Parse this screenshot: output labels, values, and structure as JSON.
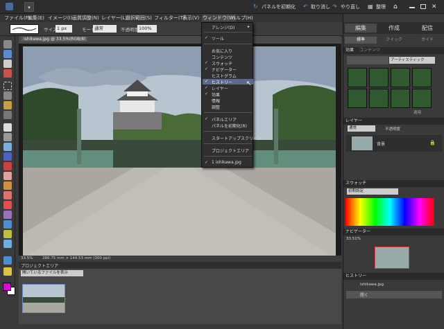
{
  "menubar": {
    "items": [
      "ファイル(F)",
      "編集(E)",
      "イメージ(I)",
      "画質調整(N)",
      "レイヤー(L)",
      "選択範囲(S)",
      "フィルター(T)",
      "表示(V)",
      "ウィンドウ(W)",
      "ヘルプ(H)"
    ]
  },
  "header": {
    "reset_panels": "パネルを初期化",
    "undo": "取り消し",
    "redo": "やり直し",
    "organize": "整理"
  },
  "options": {
    "size_label": "サイズ",
    "size_value": "1 px",
    "mode_label": "モード",
    "mode_value": "通常",
    "opacity_label": "不透明度",
    "opacity_value": "100%"
  },
  "document": {
    "tab": "ishikawa.jpg @ 33.5%(RGB/8)",
    "status": "33.5%",
    "status_info": "266.75 mm × 144.53 mm (300 ppi)"
  },
  "project": {
    "title": "プロジェクトエリア",
    "selector": "開いているファイルを表示"
  },
  "right": {
    "tabs": [
      "編集",
      "作成",
      "配信"
    ],
    "subtabs": [
      "標準",
      "クイック",
      "ガイド"
    ],
    "effects_tab1": "効果",
    "effects_tab2": "コンテンツ",
    "effects_select": "アーティスティック",
    "apply": "適用",
    "layers_title": "レイヤー",
    "blend": "通常",
    "opacity": "不透明度",
    "layer_name": "背景",
    "swatches_title": "スウォッチ",
    "swatch_select": "初期設定",
    "navigator_title": "ナビゲーター",
    "zoom": "33.51%",
    "history_title": "ヒストリー",
    "history_items": [
      "ishikawa.jpg",
      "開く"
    ]
  },
  "window_menu": {
    "items": [
      "アレンジ(D)",
      "ツール",
      "お気に入り",
      "コンテンツ",
      "スウォッチ",
      "ナビゲーター",
      "ヒストグラム",
      "ヒストリー",
      "レイヤー",
      "効果",
      "情報",
      "調整",
      "パネルエリア",
      "パネルを初期化(R)",
      "スタートアップスクリーン",
      "プロジェクトエリア",
      "1 ishikawa.jpg"
    ]
  },
  "colors": {
    "foreground": "#e000e0",
    "background": "#ffffff",
    "accent": "#596a8a"
  }
}
